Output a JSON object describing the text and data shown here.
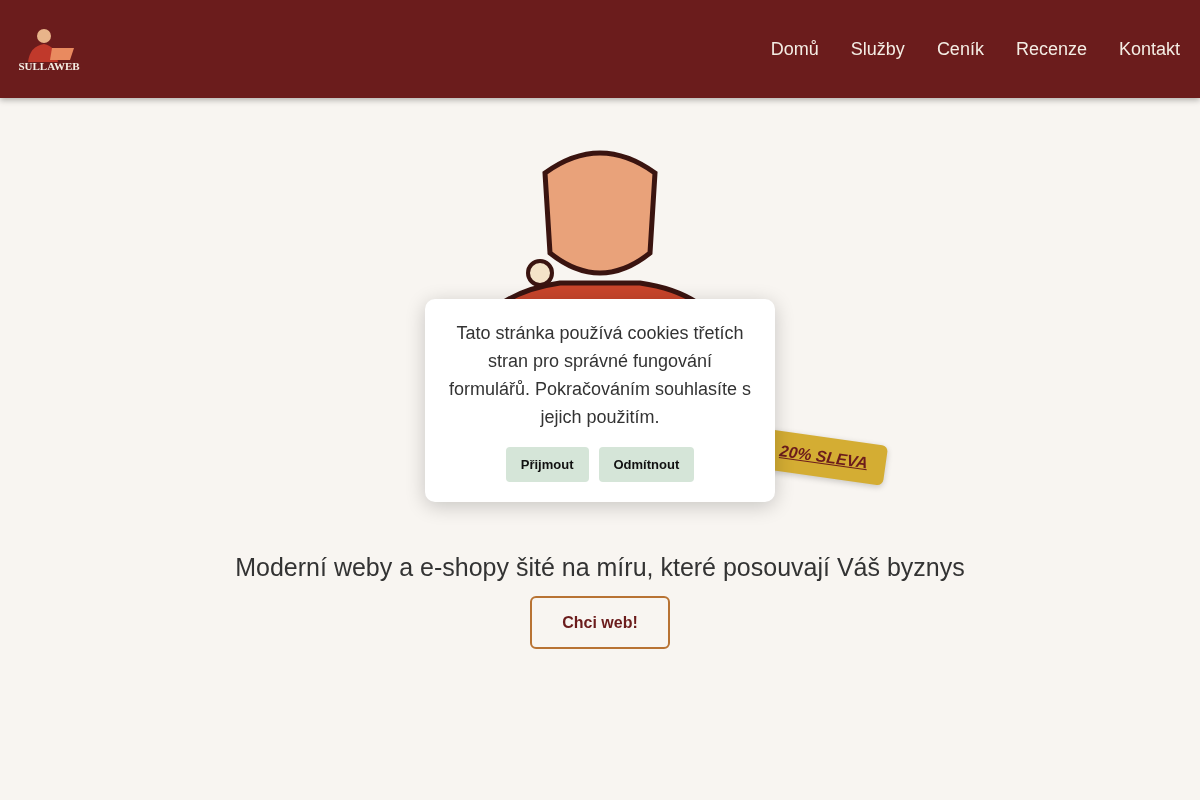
{
  "header": {
    "logo_text": "SULLAWEB",
    "nav": [
      {
        "label": "Domů"
      },
      {
        "label": "Služby"
      },
      {
        "label": "Ceník"
      },
      {
        "label": "Recenze"
      },
      {
        "label": "Kontakt"
      }
    ]
  },
  "hero": {
    "badge": "20% SLEVA",
    "subtitle": "Moderní weby a e-shopy šité na míru, které posouvají Váš byznys",
    "cta": "Chci web!"
  },
  "cookie_dialog": {
    "message": "Tato stránka používá cookies třetích stran pro správné fungování formulářů. Pokračováním souhlasíte s jejich použitím.",
    "buttons": [
      {
        "label": "Přijmout"
      },
      {
        "label": "Odmítnout"
      }
    ]
  }
}
